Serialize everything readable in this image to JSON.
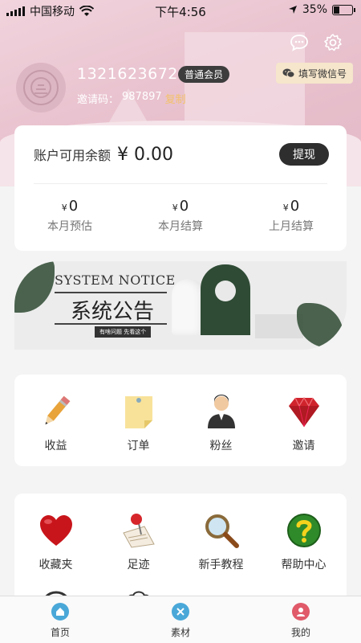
{
  "status_bar": {
    "carrier": "中国移动",
    "time": "下午4:56",
    "battery": "35%",
    "battery_level": 0.35
  },
  "profile": {
    "phone": "13216236721",
    "member_level": "普通会员",
    "invite_label": "邀请码：",
    "invite_code": "987897",
    "copy_label": "复制"
  },
  "header": {
    "wechat_button": "填写微信号"
  },
  "balance": {
    "label": "账户可用余额",
    "currency": "¥",
    "amount": "0.00",
    "withdraw_label": "提现",
    "stats": [
      {
        "value": "0",
        "label": "本月预估"
      },
      {
        "value": "0",
        "label": "本月结算"
      },
      {
        "value": "0",
        "label": "上月结算"
      }
    ]
  },
  "banner": {
    "title_en": "SYSTEM NOTICE",
    "title_cn": "系统公告",
    "tagline": "有啥问题 先看这个"
  },
  "menu_primary": [
    {
      "label": "收益",
      "icon": "pencil-icon"
    },
    {
      "label": "订单",
      "icon": "note-icon"
    },
    {
      "label": "粉丝",
      "icon": "person-icon"
    },
    {
      "label": "邀请",
      "icon": "gem-icon"
    }
  ],
  "menu_secondary": [
    {
      "label": "收藏夹",
      "icon": "heart-icon"
    },
    {
      "label": "足迹",
      "icon": "pushpin-icon"
    },
    {
      "label": "新手教程",
      "icon": "magnifier-icon"
    },
    {
      "label": "帮助中心",
      "icon": "help-icon"
    }
  ],
  "tabbar": [
    {
      "label": "首页",
      "icon": "home-icon",
      "color": "#4aa8d8"
    },
    {
      "label": "素材",
      "icon": "material-icon",
      "color": "#4aa8d8"
    },
    {
      "label": "我的",
      "icon": "profile-icon",
      "color": "#e05a6a"
    }
  ],
  "colors": {
    "accent_dark": "#2e2e2e",
    "hero_pink": "#e9c3cf",
    "copy_gold": "#f3c26a"
  }
}
